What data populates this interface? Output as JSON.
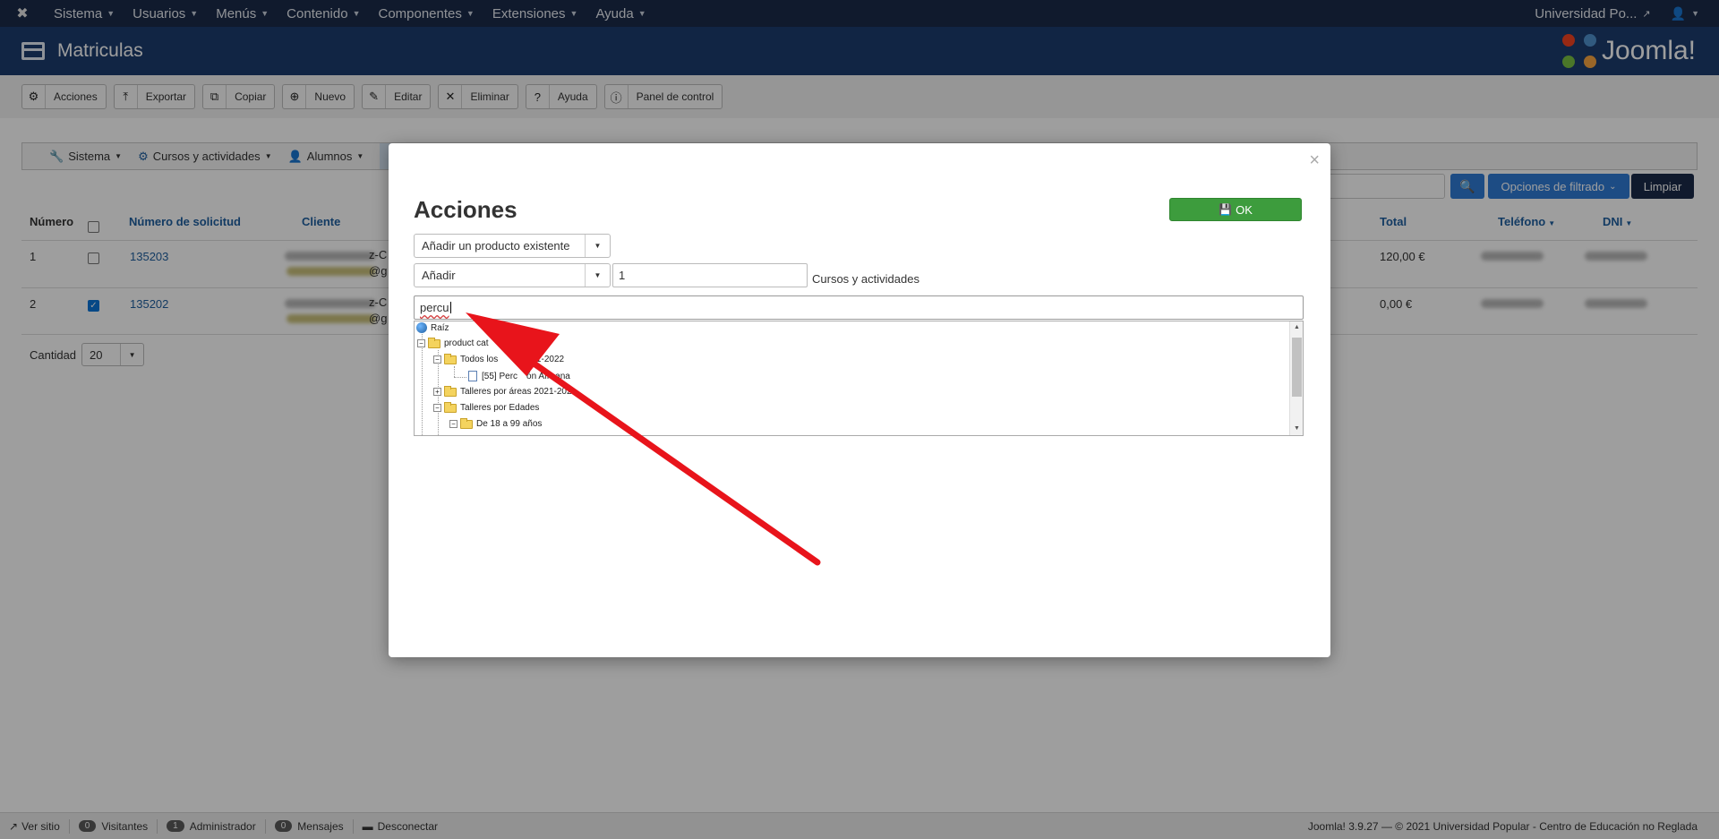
{
  "topnav": {
    "menu": [
      {
        "label": "Sistema"
      },
      {
        "label": "Usuarios"
      },
      {
        "label": "Menús"
      },
      {
        "label": "Contenido"
      },
      {
        "label": "Componentes"
      },
      {
        "label": "Extensiones"
      },
      {
        "label": "Ayuda"
      }
    ],
    "site_label": "Universidad Po...",
    "user_icon": "user-icon"
  },
  "titlebar": {
    "title": "Matriculas",
    "brand": "Joomla!"
  },
  "toolbar": {
    "buttons": [
      {
        "label": "Acciones",
        "icon": "gears-icon",
        "glyph": "⚙"
      },
      {
        "label": "Exportar",
        "icon": "upload-icon",
        "glyph": "⤒"
      },
      {
        "label": "Copiar",
        "icon": "copy-icon",
        "glyph": "⧉"
      },
      {
        "label": "Nuevo",
        "icon": "plus-circle-icon",
        "glyph": "⊕"
      },
      {
        "label": "Editar",
        "icon": "edit-icon",
        "glyph": "✎"
      },
      {
        "label": "Eliminar",
        "icon": "delete-icon",
        "glyph": "✕"
      },
      {
        "label": "Ayuda",
        "icon": "help-icon",
        "glyph": "?"
      },
      {
        "label": "Panel de control",
        "icon": "info-icon",
        "glyph": "ⓘ"
      }
    ]
  },
  "subnav": {
    "items": [
      {
        "label": "Sistema",
        "glyph": "🔧"
      },
      {
        "label": "Cursos y actividades",
        "glyph": "⚙"
      },
      {
        "label": "Alumnos",
        "glyph": "👤"
      }
    ]
  },
  "filters": {
    "filter_label": "Opciones de filtrado",
    "clear_label": "Limpiar"
  },
  "table": {
    "headers": {
      "numero": "Número",
      "solicitud": "Número de solicitud",
      "cliente": "Cliente",
      "total": "Total",
      "telefono": "Teléfono",
      "dni": "DNI"
    },
    "rows": [
      {
        "numero": "1",
        "solicitud": "135203",
        "cliente_a": "z-C",
        "cliente_b": "@g",
        "total": "120,00 €",
        "checked": false
      },
      {
        "numero": "2",
        "solicitud": "135202",
        "cliente_a": "z-C",
        "cliente_b": "@g",
        "total": "0,00 €",
        "checked": true
      }
    ],
    "cantidad_label": "Cantidad",
    "cantidad_value": "20"
  },
  "modal": {
    "title": "Acciones",
    "ok_label": "OK",
    "close_glyph": "×",
    "product_select": "Añadir un producto existente",
    "action_select": "Añadir",
    "quantity": "1",
    "quantity_label": "Cursos y actividades",
    "search_value": "percu",
    "tree": {
      "root": "Raíz",
      "n1": "product cat",
      "n2a": "Todos los",
      "n2b": "2021-2022",
      "n3a": "[55] Perc",
      "n3b": "ón Afr",
      "n3c": "ana",
      "n4a": "Talleres por áreas 2021-20",
      "n4b": "2",
      "n5": "Talleres por Edades",
      "n6": "De 18 a 99 años"
    }
  },
  "footer": {
    "ver_sitio": "Ver sitio",
    "visitantes_count": "0",
    "visitantes": "Visitantes",
    "admin_count": "1",
    "admin": "Administrador",
    "mensajes_count": "0",
    "mensajes": "Mensajes",
    "desconectar": "Desconectar",
    "version": "Joomla! 3.9.27",
    "copyright": "— © 2021 Universidad Popular - Centro de Educación no Reglada"
  },
  "colors": {
    "navbar": "#1a2b4a",
    "titlebar": "#1c3d6e",
    "accent": "#2f7bd6",
    "ok": "#3d9c3d",
    "arrow": "#e8141b"
  }
}
